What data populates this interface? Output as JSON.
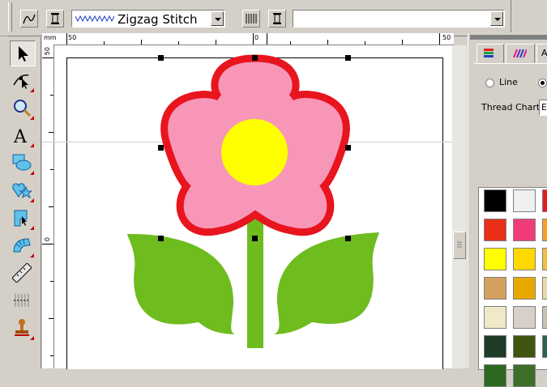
{
  "toolbar": {
    "stitch_type": "Zigzag Stitch",
    "fill_pattern": ""
  },
  "ruler": {
    "unit": "mm",
    "top_labels": [
      "50",
      "0",
      "50"
    ],
    "left_labels": [
      "50",
      "0"
    ]
  },
  "panel": {
    "tab_partial": "A",
    "radio_line": "Line",
    "thread_chart_label": "Thread Chart:",
    "thread_chart_value": "E"
  },
  "colors": {
    "petal_fill": "#f896b8",
    "petal_outline": "#e8141e",
    "center": "#ffff00",
    "leaf": "#6ebc1e",
    "swatches": [
      "#000000",
      "#f0f0f0",
      "#e41e1e",
      "#e83018",
      "#f03c78",
      "#ffa020",
      "#ffff00",
      "#ffd800",
      "#f0c040",
      "#d4a060",
      "#e8a800",
      "#e8d8b0",
      "#f0e8c8",
      "#d8d0c8",
      "#c8c0b0",
      "#1e3c28",
      "#40560e",
      "#286450",
      "#2c6820",
      "#3c7028"
    ]
  }
}
